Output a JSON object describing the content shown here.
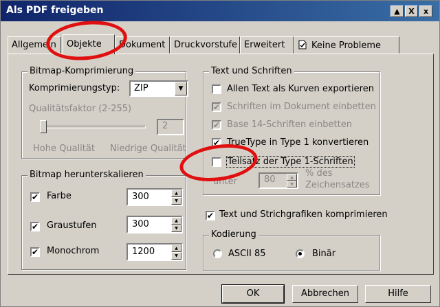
{
  "window": {
    "title": "Als PDF freigeben",
    "controls": [
      "▲",
      "X",
      "x"
    ]
  },
  "tabs": [
    {
      "label": "Allgemein"
    },
    {
      "label": "Objekte"
    },
    {
      "label": "Dokument"
    },
    {
      "label": "Druckvorstufe"
    },
    {
      "label": "Erweitert"
    },
    {
      "label": "Keine Probleme",
      "icon": "check-document-icon"
    }
  ],
  "bitmap_compression": {
    "title": "Bitmap-Komprimierung",
    "type_label": "Komprimierungstyp:",
    "type_value": "ZIP",
    "quality_label": "Qualitätsfaktor (2-255)",
    "quality_value": "2",
    "high_label": "Hohe Qualität",
    "low_label": "Niedrige Qualität"
  },
  "bitmap_downsample": {
    "title": "Bitmap herunterskalieren",
    "rows": [
      {
        "label": "Farbe",
        "checked": true,
        "value": "300"
      },
      {
        "label": "Graustufen",
        "checked": true,
        "value": "300"
      },
      {
        "label": "Monochrom",
        "checked": true,
        "value": "1200"
      }
    ]
  },
  "text_fonts": {
    "title": "Text und Schriften",
    "options": [
      {
        "label": "Allen Text als Kurven exportieren",
        "checked": false,
        "enabled": true
      },
      {
        "label": "Schriften im Dokument einbetten",
        "checked": true,
        "enabled": false
      },
      {
        "label": "Base 14-Schriften einbetten",
        "checked": true,
        "enabled": false
      },
      {
        "label": "TrueType in Type 1 konvertieren",
        "checked": true,
        "enabled": true
      },
      {
        "label": "Teilsatz der Type 1-Schriften",
        "checked": false,
        "enabled": true
      }
    ],
    "subset_prefix": "unter",
    "subset_value": "80",
    "subset_suffix_1": "% des",
    "subset_suffix_2": "Zeichensatzes"
  },
  "compress": {
    "label": "Text und Strichgrafiken komprimieren",
    "checked": true
  },
  "encoding": {
    "title": "Kodierung",
    "options": [
      {
        "label": "ASCII 85",
        "selected": false
      },
      {
        "label": "Binär",
        "selected": true
      }
    ]
  },
  "buttons": {
    "ok": "OK",
    "cancel": "Abbrechen",
    "help": "Hilfe"
  },
  "colors": {
    "face": "#d4d0c8",
    "title_start": "#10246a",
    "title_end": "#3a6ea5",
    "annotation": "#e01010"
  }
}
